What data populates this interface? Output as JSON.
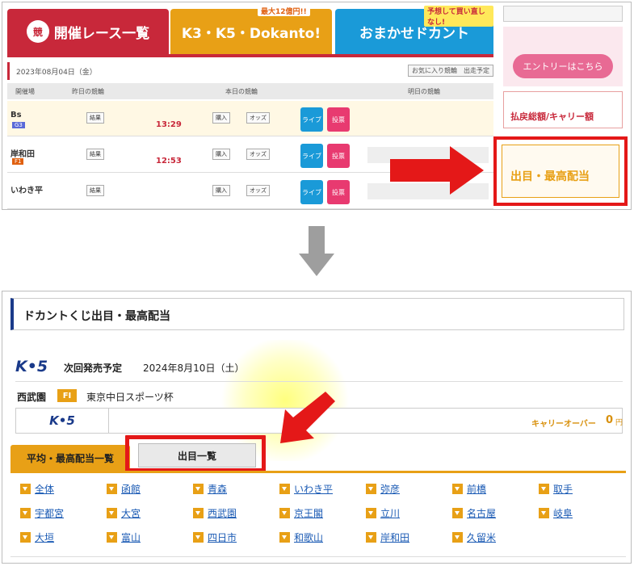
{
  "top": {
    "tabs": {
      "kaisai": "開催レース一覧",
      "k3": "K3・K5・Dokanto!",
      "k3_badge": "最大12億円!!",
      "omakase": "おまかせドカント",
      "omakase_badge": "予想して買い直しなし!"
    },
    "date": "2023年08月04日（金）",
    "fav_button": "お気に入り競輪　出走予定",
    "headers": [
      "開催場",
      "昨日の競輪",
      "本日の競輪",
      "明日の競輪"
    ],
    "rows": [
      {
        "venue": "Bs",
        "grade": "G3",
        "time": "13:29"
      },
      {
        "venue": "岸和田",
        "grade": "F1",
        "time": "12:53"
      },
      {
        "venue": "いわき平",
        "grade": "",
        "time": ""
      }
    ],
    "side": {
      "entry": "エントリーはこちら",
      "career": "払戻総額/キャリー額",
      "result": "出目・最高配当"
    }
  },
  "bottom": {
    "title": "ドカントくじ出目・最高配当",
    "k5_logo": "K•5",
    "next_label": "次回発売予定",
    "next_date": "2024年8月10日（土）",
    "venue": "西武園",
    "grade": "FI",
    "race_name": "東京中日スポーツ杯",
    "carryover_label": "キャリーオーバー",
    "carryover_amount": "0",
    "yen": "円",
    "tab_avg": "平均・最高配当一覧",
    "tab_list": "出目一覧",
    "venues": [
      "全体",
      "函館",
      "青森",
      "いわき平",
      "弥彦",
      "前橋",
      "取手",
      "宇都宮",
      "大宮",
      "西武園",
      "京王閣",
      "立川",
      "名古屋",
      "岐阜",
      "大垣",
      "富山",
      "四日市",
      "和歌山",
      "岸和田",
      "久留米"
    ]
  },
  "colors": {
    "red": "#c8283a",
    "orange": "#e8a016",
    "blue": "#1a9ad8",
    "highlight": "#e41818",
    "link": "#1a5ab4"
  }
}
